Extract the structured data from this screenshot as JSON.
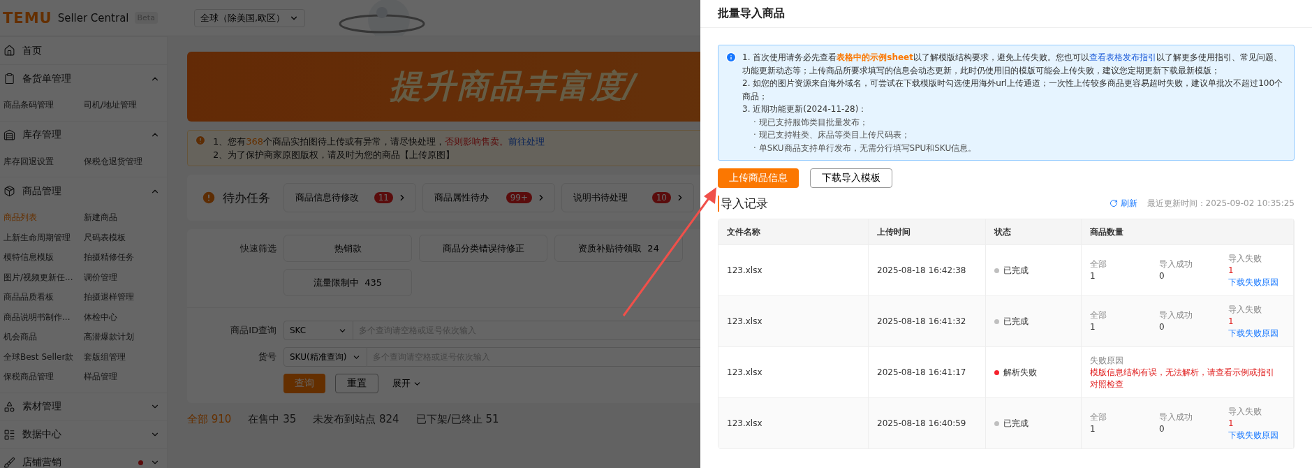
{
  "header": {
    "brand": "TEMU",
    "product": "Seller Central",
    "badge": "Beta",
    "region": "全球（除美国,欧区）"
  },
  "sidebar": {
    "sections": [
      {
        "label": "首页",
        "kind": "link",
        "dot": false
      },
      {
        "label": "备货单管理",
        "kind": "group",
        "expanded": true,
        "dot": false,
        "children": [
          {
            "label": "商品条码管理",
            "selected": false
          },
          {
            "label": "司机/地址管理",
            "selected": false
          }
        ]
      },
      {
        "label": "库存管理",
        "kind": "group",
        "expanded": true,
        "dot": false,
        "children": [
          {
            "label": "库存回退设置",
            "selected": false
          },
          {
            "label": "保税仓退货管理",
            "selected": false
          }
        ]
      },
      {
        "label": "商品管理",
        "kind": "group",
        "expanded": true,
        "dot": false,
        "children": [
          {
            "label": "商品列表",
            "selected": true
          },
          {
            "label": "新建商品",
            "selected": false
          },
          {
            "label": "上新生命周期管理",
            "selected": false
          },
          {
            "label": "尺码表模板",
            "selected": false
          },
          {
            "label": "模特信息模版",
            "selected": false
          },
          {
            "label": "拍摄精修任务",
            "selected": false
          },
          {
            "label": "图片/视频更新任...",
            "selected": false
          },
          {
            "label": "调价管理",
            "selected": false
          },
          {
            "label": "商品品质看板",
            "selected": false
          },
          {
            "label": "拍摄退样管理",
            "selected": false
          },
          {
            "label": "商品说明书制作...",
            "selected": false
          },
          {
            "label": "体检中心",
            "selected": false
          },
          {
            "label": "机会商品",
            "selected": false
          },
          {
            "label": "高潜爆款计划",
            "selected": false
          },
          {
            "label": "全球Best Seller款",
            "selected": false
          },
          {
            "label": "套版组管理",
            "selected": false
          },
          {
            "label": "保税商品管理",
            "selected": false
          },
          {
            "label": "样品管理",
            "selected": false
          }
        ]
      },
      {
        "label": "素材管理",
        "kind": "group",
        "expanded": false,
        "dot": false
      },
      {
        "label": "数据中心",
        "kind": "group",
        "expanded": false,
        "dot": false
      },
      {
        "label": "店铺营销",
        "kind": "group",
        "expanded": false,
        "dot": true
      }
    ]
  },
  "banner": {
    "headline": "提升商品丰富度/"
  },
  "notice": {
    "lines": [
      [
        {
          "kind": "plain",
          "text": "1、您有"
        },
        {
          "kind": "highlight",
          "text": "368"
        },
        {
          "kind": "plain",
          "text": "个商品实拍图待上传或有异常，请尽快处理，"
        },
        {
          "kind": "warning",
          "text": "否则影响售卖。"
        },
        {
          "kind": "link",
          "text": "前往处理"
        }
      ],
      [
        {
          "kind": "plain",
          "text": "2、为了保护商家原图版权，请及时为您的商品【上传原图】"
        }
      ]
    ]
  },
  "todo": {
    "title": "待办任务",
    "cards": [
      {
        "label": "商品信息待修改",
        "count": "11"
      },
      {
        "label": "商品属性待办",
        "count": "99+"
      },
      {
        "label": "说明书待处理",
        "count": "10"
      }
    ]
  },
  "filters": {
    "quick_label": "快速筛选",
    "quick": [
      "热销款",
      "商品分类错误待修正",
      "资质补贴待领取  24",
      "流量限制中  435"
    ],
    "fields": [
      {
        "label": "商品ID查询",
        "select": "SKC",
        "placeholder": "多个查询请空格或逗号依次输入"
      },
      {
        "label": "货号",
        "select": "SKU(精准查询)",
        "placeholder": "多个查询请空格或逗号依次输入"
      }
    ],
    "search_button": "查询",
    "reset_button": "重置",
    "expand": "展开"
  },
  "status_tabs": [
    {
      "label": "全部 910",
      "selected": true
    },
    {
      "label": "在售中 35",
      "selected": false
    },
    {
      "label": "未发布到站点 824",
      "selected": false
    },
    {
      "label": "已下架/已终止 51",
      "selected": false
    }
  ],
  "drawer": {
    "title": "批量导入商品",
    "info": {
      "items": [
        [
          {
            "kind": "plain",
            "text": "1. 首次使用请务必先查看"
          },
          {
            "kind": "strong_link",
            "text": "表格中的示例sheet"
          },
          {
            "kind": "plain",
            "text": "以了解模版结构要求，避免上传失败。您也可以"
          },
          {
            "kind": "link",
            "text": "查看表格发布指引"
          },
          {
            "kind": "plain",
            "text": "以了解更多使用指引、常见问题、功能更新动态等；上传商品所要求填写的信息会动态更新，此时仍使用旧的模版可能会上传失败，建议您定期更新下载最新模版；"
          }
        ],
        [
          {
            "kind": "plain",
            "text": "2. 如您的图片资源来自海外域名，可尝试在下载模版时勾选使用海外url上传通道；一次性上传较多商品更容易超时失败，建议单批次不超过100个商品；"
          }
        ],
        [
          {
            "kind": "plain",
            "text": "3. 近期功能更新(2024-11-28)："
          }
        ]
      ],
      "subitems": [
        "· 现已支持服饰类目批量发布；",
        "· 现已支持鞋类、床品等类目上传尺码表；",
        "· 单SKU商品支持单行发布，无需分行填写SPU和SKU信息。"
      ]
    },
    "upload_button": "上传商品信息",
    "template_button": "下载导入模板",
    "records": {
      "title": "导入记录",
      "refresh": "刷新",
      "updated": "最近更新时间：2025-09-02 10:35:25",
      "columns": [
        "文件名称",
        "上传时间",
        "状态",
        "商品数量"
      ],
      "rows": [
        {
          "kind": "counts",
          "file": "123.xlsx",
          "time": "2025-08-18 16:42:38",
          "status": {
            "text": "已完成",
            "color": "#bfbfbf"
          },
          "all_label": "全部",
          "all": "1",
          "success_label": "导入成功",
          "success": "0",
          "fail_label": "导入失败",
          "fail": "1",
          "fail_link": "下载失败原因"
        },
        {
          "kind": "counts",
          "file": "123.xlsx",
          "time": "2025-08-18 16:41:32",
          "status": {
            "text": "已完成",
            "color": "#bfbfbf"
          },
          "all_label": "全部",
          "all": "1",
          "success_label": "导入成功",
          "success": "0",
          "fail_label": "导入失败",
          "fail": "1",
          "fail_link": "下载失败原因"
        },
        {
          "kind": "error",
          "file": "123.xlsx",
          "time": "2025-08-18 16:41:17",
          "status": {
            "text": "解析失败",
            "color": "#f5222d"
          },
          "reason_label": "失败原因",
          "reason": "模版信息结构有误，无法解析，请查看示例或指引对照检查"
        },
        {
          "kind": "counts",
          "file": "123.xlsx",
          "time": "2025-08-18 16:40:59",
          "status": {
            "text": "已完成",
            "color": "#bfbfbf"
          },
          "all_label": "全部",
          "all": "1",
          "success_label": "导入成功",
          "success": "0",
          "fail_label": "导入失败",
          "fail": "1",
          "fail_link": "下载失败原因"
        }
      ]
    }
  }
}
